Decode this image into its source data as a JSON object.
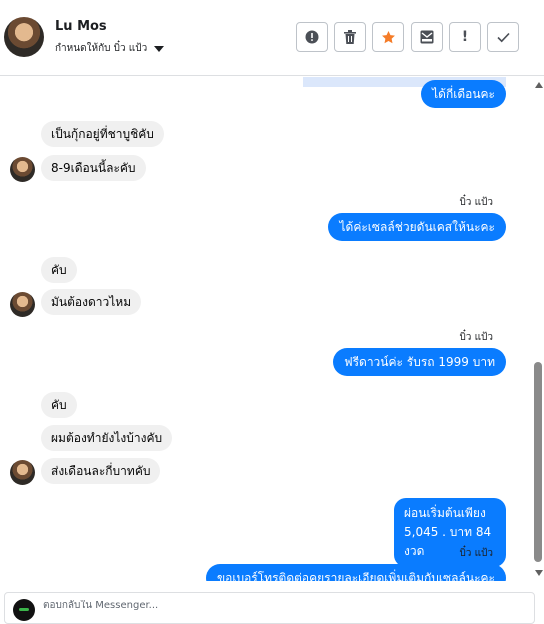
{
  "header": {
    "contact_name": "Lu Mos",
    "assigned_to": "กำหนดให้กับ บิ๋ว แป้ว",
    "actions": [
      {
        "name": "mark-spam-button",
        "icon": "!"
      },
      {
        "name": "delete-button",
        "icon": "🗑"
      },
      {
        "name": "star-button",
        "icon": "★"
      },
      {
        "name": "archive-button",
        "icon": "✉"
      },
      {
        "name": "flag-button",
        "icon": "!"
      },
      {
        "name": "done-button",
        "icon": "✓"
      }
    ]
  },
  "messages": [
    {
      "dir": "out",
      "text": "ได้กี่เดือนคะ"
    },
    {
      "dir": "in",
      "text": "เป็นกุ้กอยู่ที่ชาบูชิคับ"
    },
    {
      "dir": "in",
      "text": "8-9เดือนนี้ละคับ"
    },
    {
      "dir": "out",
      "sender": "บิ๋ว แป้ว",
      "text": "ได้ค่ะเซลล์ช่วยดันเคสให้นะคะ"
    },
    {
      "dir": "in",
      "text": "คับ"
    },
    {
      "dir": "in",
      "text": "มันต้องดาวไหม"
    },
    {
      "dir": "out",
      "sender": "บิ๋ว แป้ว",
      "text": "ฟรีดาวน์ค่ะ  รับรถ 1999 บาท"
    },
    {
      "dir": "in",
      "text": "คับ"
    },
    {
      "dir": "in",
      "text": "ผมต้องทำยังไงบ้างคับ"
    },
    {
      "dir": "in",
      "text": "ส่งเดือนละกี่บาทคับ"
    },
    {
      "dir": "out",
      "text": "ผ่อนเริ่มต้นเพียง 5,045 . บาท 84 งวด"
    },
    {
      "dir": "out",
      "sender": "บิ๋ว แป้ว",
      "text": "ขอเบอร์โทรติดต่อคุยรายละเอียดเพิ่มเติมกับเซลล์นะคะ"
    }
  ],
  "composer": {
    "placeholder": "ตอบกลับใน Messenger..."
  },
  "colors": {
    "outgoing_bubble": "#0a7cff",
    "incoming_bubble": "#f0f0f0",
    "star_accent": "#f57c28"
  }
}
